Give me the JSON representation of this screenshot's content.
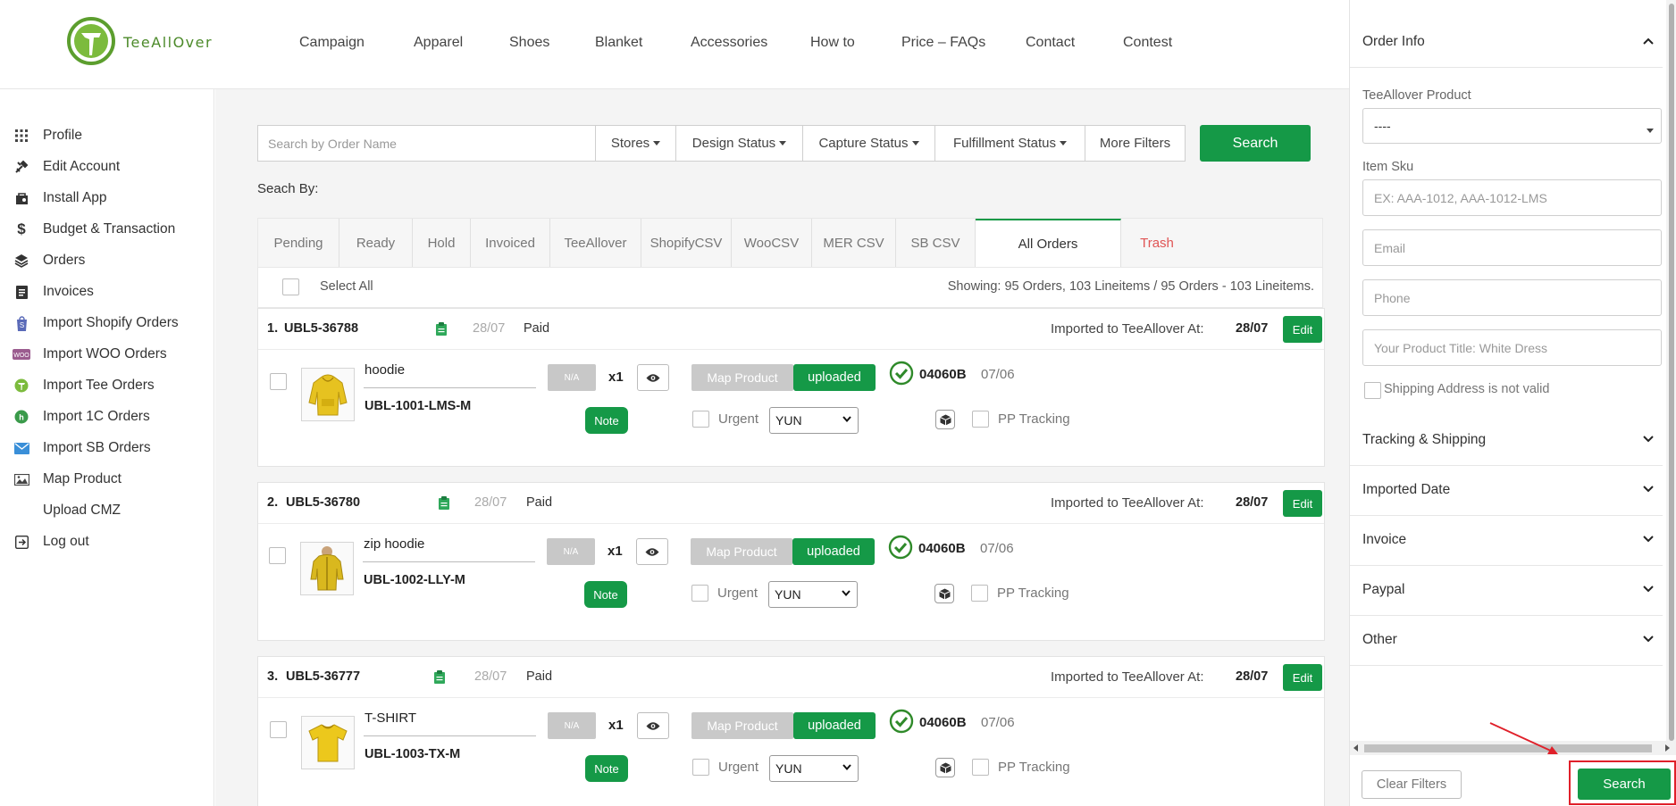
{
  "brand": {
    "name": "TeeAllOver"
  },
  "nav": [
    "Campaign",
    "Apparel",
    "Shoes",
    "Blanket",
    "Accessories",
    "How to",
    "Price – FAQs",
    "Contact",
    "Contest"
  ],
  "sidebar": [
    {
      "label": "Profile",
      "icon": "grid-icon"
    },
    {
      "label": "Edit Account",
      "icon": "tools-icon"
    },
    {
      "label": "Install App",
      "icon": "bag-icon"
    },
    {
      "label": "Budget & Transaction",
      "icon": "dollar-icon"
    },
    {
      "label": "Orders",
      "icon": "layers-icon"
    },
    {
      "label": "Invoices",
      "icon": "document-icon"
    },
    {
      "label": "Import Shopify Orders",
      "icon": "shopify-icon"
    },
    {
      "label": "Import WOO Orders",
      "icon": "woo-icon"
    },
    {
      "label": "Import Tee Orders",
      "icon": "tee-icon"
    },
    {
      "label": "Import 1C Orders",
      "icon": "onec-icon"
    },
    {
      "label": "Import SB Orders",
      "icon": "mail-icon"
    },
    {
      "label": "Map Product",
      "icon": "image-icon"
    },
    {
      "label": "Upload CMZ",
      "icon": ""
    },
    {
      "label": "Log out",
      "icon": "logout-icon"
    }
  ],
  "filters": {
    "search_placeholder": "Search by Order Name",
    "stores": "Stores",
    "design_status": "Design Status",
    "capture_status": "Capture Status",
    "fulfillment_status": "Fulfillment Status",
    "more_filters": "More Filters",
    "search_button": "Search"
  },
  "search_by_label": "Seach By:",
  "tabs": [
    "Pending",
    "Ready",
    "Hold",
    "Invoiced",
    "TeeAllover",
    "ShopifyCSV",
    "WooCSV",
    "MER CSV",
    "SB CSV",
    "All Orders",
    "Trash"
  ],
  "select_all": "Select All",
  "showing": "Showing: 95 Orders, 103 Lineitems / 95 Orders - 103 Lineitems.",
  "orders": [
    {
      "num": "1.",
      "id": "UBL5-36788",
      "date": "28/07",
      "status": "Paid",
      "imported_label": "Imported to TeeAllover At:",
      "imported_date": "28/07",
      "edit": "Edit",
      "product": "hoodie",
      "sku": "UBL-1001-LMS-M",
      "na": "N/A",
      "qty": "x1",
      "note": "Note",
      "map_product": "Map Product",
      "uploaded": "uploaded",
      "urgent": "Urgent",
      "shipping": "YUN",
      "code": "04060B",
      "code_date": "07/06",
      "pp_tracking": "PP Tracking",
      "thumb": "hoodie"
    },
    {
      "num": "2.",
      "id": "UBL5-36780",
      "date": "28/07",
      "status": "Paid",
      "imported_label": "Imported to TeeAllover At:",
      "imported_date": "28/07",
      "edit": "Edit",
      "product": "zip hoodie",
      "sku": "UBL-1002-LLY-M",
      "na": "N/A",
      "qty": "x1",
      "note": "Note",
      "map_product": "Map Product",
      "uploaded": "uploaded",
      "urgent": "Urgent",
      "shipping": "YUN",
      "code": "04060B",
      "code_date": "07/06",
      "pp_tracking": "PP Tracking",
      "thumb": "zip"
    },
    {
      "num": "3.",
      "id": "UBL5-36777",
      "date": "28/07",
      "status": "Paid",
      "imported_label": "Imported to TeeAllover At:",
      "imported_date": "28/07",
      "edit": "Edit",
      "product": "T-SHIRT",
      "sku": "UBL-1003-TX-M",
      "na": "N/A",
      "qty": "x1",
      "note": "Note",
      "map_product": "Map Product",
      "uploaded": "uploaded",
      "urgent": "Urgent",
      "shipping": "YUN",
      "code": "04060B",
      "code_date": "07/06",
      "pp_tracking": "PP Tracking",
      "thumb": "tshirt"
    }
  ],
  "panel": {
    "order_info": "Order Info",
    "product_label": "TeeAllover Product",
    "product_value": "----",
    "sku_label": "Item Sku",
    "sku_placeholder": "EX: AAA-1012, AAA-1012-LMS",
    "email_placeholder": "Email",
    "phone_placeholder": "Phone",
    "title_placeholder": "Your Product Title: White Dress",
    "shipping_invalid": "Shipping Address is not valid",
    "sections": [
      "Tracking & Shipping",
      "Imported Date",
      "Invoice",
      "Paypal",
      "Other"
    ],
    "clear_filters": "Clear Filters",
    "search": "Search"
  },
  "colors": {
    "accent": "#159947",
    "trash": "#e05454",
    "highlight": "#e0202a"
  }
}
